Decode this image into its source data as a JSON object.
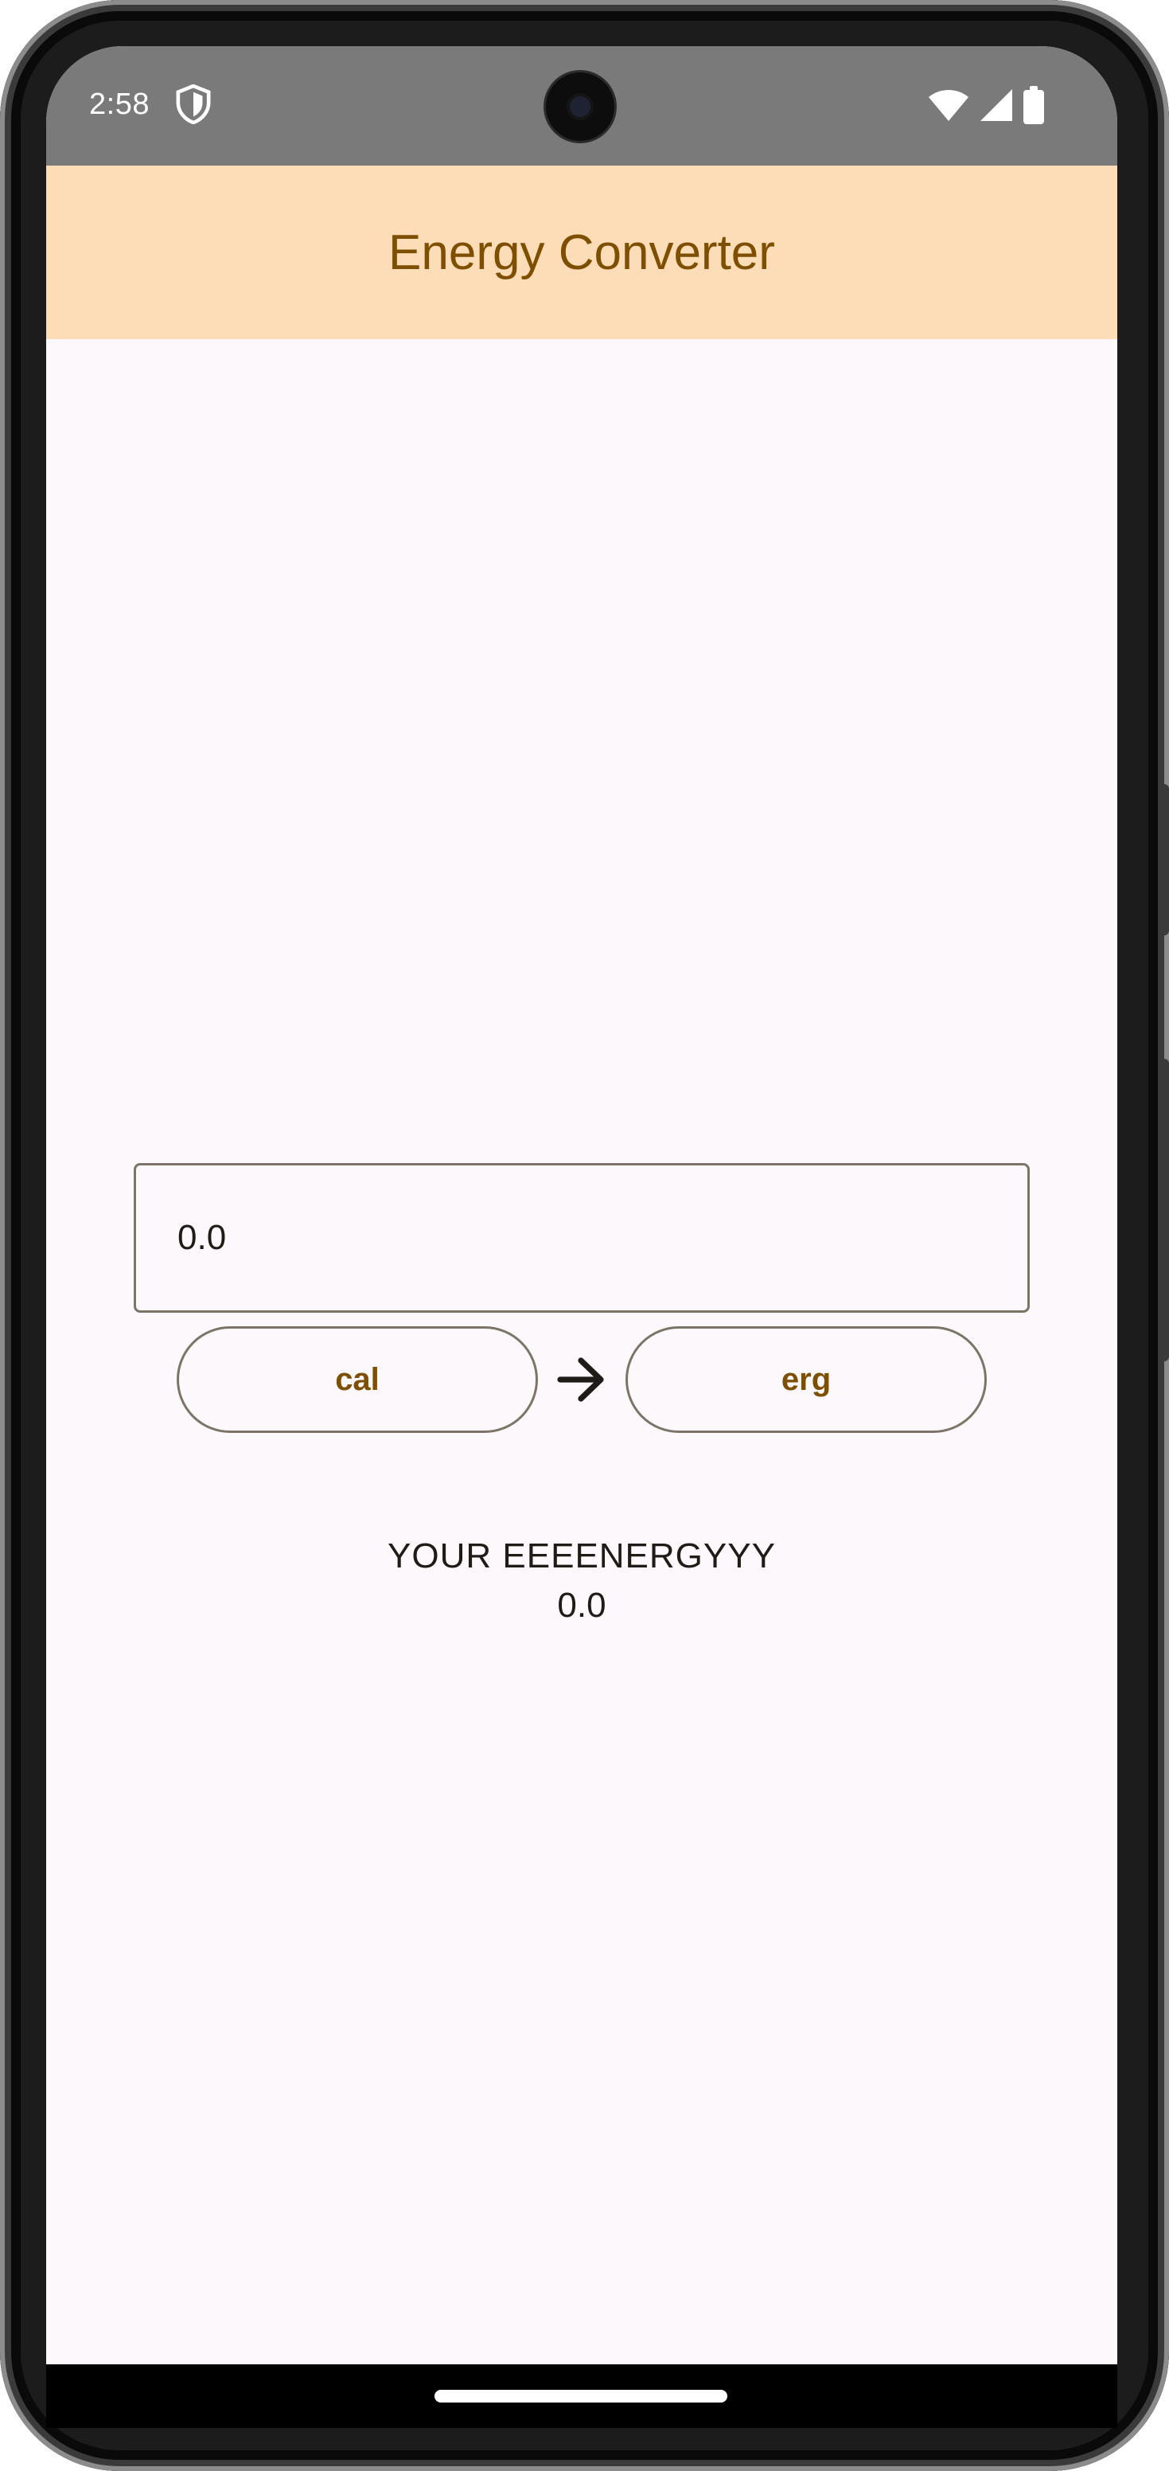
{
  "status_bar": {
    "time": "2:58",
    "icons": [
      "shield-icon",
      "wifi-icon",
      "signal-icon",
      "battery-icon"
    ]
  },
  "app_bar": {
    "title": "Energy Converter"
  },
  "converter": {
    "input_value": "0.0",
    "from_unit": "cal",
    "to_unit": "erg",
    "arrow_icon": "arrow-right-icon"
  },
  "result": {
    "label": "YOUR EEEENERGYYY",
    "value": "0.0"
  },
  "colors": {
    "app_bar_bg": "#fddcb8",
    "accent_text": "#7e4f00",
    "outline": "#7d7468",
    "surface": "#fdf8fb",
    "status_bar_bg": "#7a7a7a"
  }
}
